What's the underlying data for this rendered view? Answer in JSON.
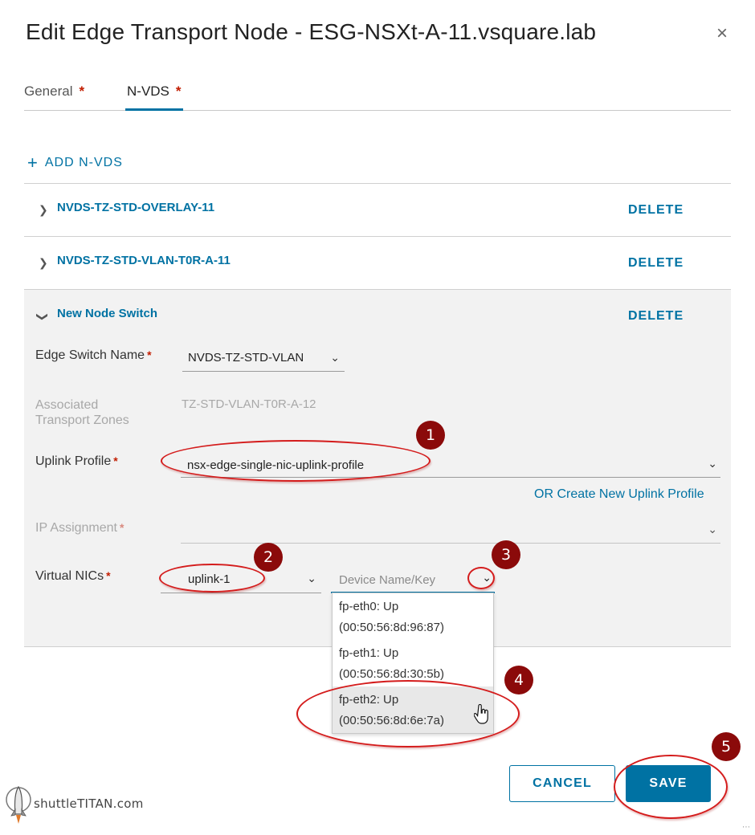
{
  "dialog": {
    "title": "Edit Edge Transport Node - ESG-NSXt-A-11.vsquare.lab",
    "close_icon": "×"
  },
  "tabs": [
    {
      "label": "General",
      "required": "*"
    },
    {
      "label": "N-VDS",
      "required": "*",
      "active": true
    }
  ],
  "add_nvds": {
    "icon": "+",
    "label": "ADD N-VDS"
  },
  "switches": [
    {
      "name": "NVDS-TZ-STD-OVERLAY-11",
      "delete": "DELETE",
      "expanded": false
    },
    {
      "name": "NVDS-TZ-STD-VLAN-T0R-A-11",
      "delete": "DELETE",
      "expanded": false
    },
    {
      "name": "New Node Switch",
      "delete": "DELETE",
      "expanded": true
    }
  ],
  "form": {
    "edge_switch_name": {
      "label": "Edge Switch Name",
      "required": "*",
      "value": "NVDS-TZ-STD-VLAN"
    },
    "assoc_tz": {
      "label_line1": "Associated",
      "label_line2": "Transport Zones",
      "value": "TZ-STD-VLAN-T0R-A-12"
    },
    "uplink_profile": {
      "label": "Uplink Profile",
      "required": "*",
      "value": "nsx-edge-single-nic-uplink-profile"
    },
    "create_uplink_link": "OR Create New Uplink Profile",
    "ip_assignment": {
      "label": "IP Assignment",
      "required": "*",
      "value": ""
    },
    "virtual_nics": {
      "label": "Virtual NICs",
      "required": "*",
      "value": "uplink-1",
      "device_placeholder": "Device Name/Key"
    }
  },
  "device_options": [
    {
      "line1": "fp-eth0: Up",
      "line2": "(00:50:56:8d:96:87)"
    },
    {
      "line1": "fp-eth1: Up",
      "line2": "(00:50:56:8d:30:5b)"
    },
    {
      "line1": "fp-eth2: Up",
      "line2": "(00:50:56:8d:6e:7a)",
      "highlighted": true
    }
  ],
  "buttons": {
    "cancel": "CANCEL",
    "save": "SAVE"
  },
  "annotations": [
    "1",
    "2",
    "3",
    "4",
    "5"
  ],
  "watermark": "shuttleTITAN.com",
  "colors": {
    "accent": "#0072a3",
    "required": "#c21d00",
    "annotation": "#8b0a0a",
    "ellipse": "#d41c1c"
  }
}
